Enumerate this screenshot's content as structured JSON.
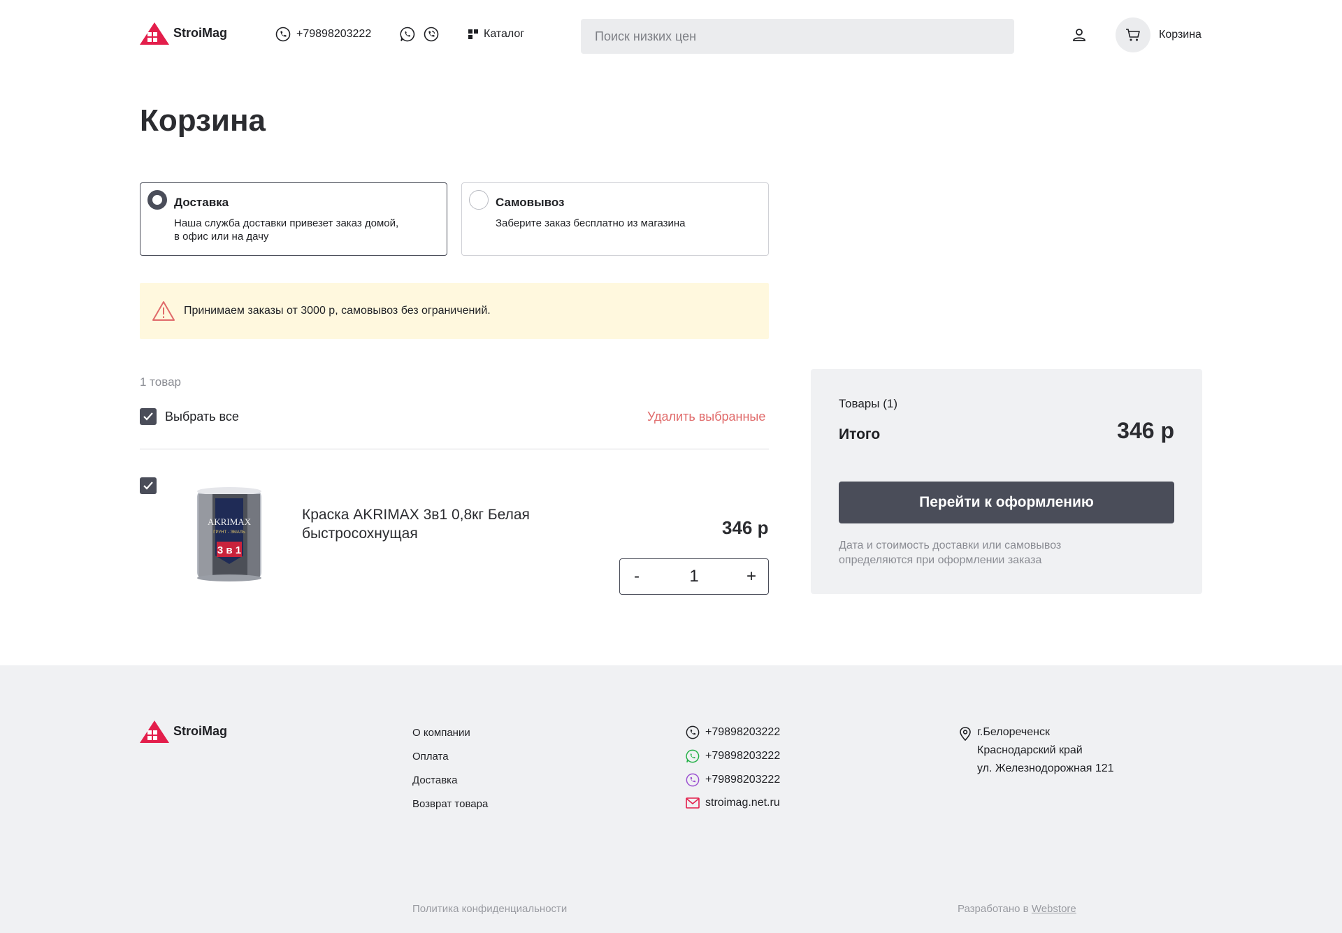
{
  "header": {
    "logo_text": "StroiMag",
    "phone": "+79898203222",
    "catalog_label": "Каталог",
    "search_placeholder": "Поиск низких цен",
    "cart_label": "Корзина"
  },
  "page_title": "Корзина",
  "delivery_options": [
    {
      "title": "Доставка",
      "desc_line1": "Наша служба доставки привезет заказ домой,",
      "desc_line2": "в офис или на дачу",
      "selected": true
    },
    {
      "title": "Самовывоз",
      "desc_line1": "Заберите заказ бесплатно из магазина",
      "desc_line2": "",
      "selected": false
    }
  ],
  "notice": "Принимаем заказы от 3000 р, самовывоз без ограничений.",
  "cart": {
    "count_label": "1 товар",
    "select_all_label": "Выбрать все",
    "delete_selected_label": "Удалить выбранные",
    "items": [
      {
        "name_line1": "Краска AKRIMAX 3в1 0,8кг Белая",
        "name_line2": "быстросохнущая",
        "price": "346 р",
        "quantity": "1",
        "checked": true,
        "image_text_brand": "AKRIMAX",
        "image_text_sub": "ГРУНТ - ЭМАЛЬ",
        "image_text_big": "3 в 1"
      }
    ],
    "minus_label": "-",
    "plus_label": "+"
  },
  "summary": {
    "items_label": "Товары (1)",
    "total_label": "Итого",
    "total_value": "346 р",
    "checkout_label": "Перейти к оформлению",
    "note_line1": "Дата и стоимость доставки или самовывоз",
    "note_line2": "определяются при оформлении заказа"
  },
  "footer": {
    "logo_text": "StroiMag",
    "links": [
      "О компании",
      "Оплата",
      "Доставка",
      "Возврат товара"
    ],
    "contacts": {
      "phone": "+79898203222",
      "whatsapp": "+79898203222",
      "viber": "+79898203222",
      "email": "stroimag.net.ru"
    },
    "address": [
      "г.Белореченск",
      "Краснодарский край",
      "ул. Железнодорожная 121"
    ],
    "privacy": "Политика конфиденциальности",
    "developed_prefix": "Разработано в",
    "developed_link": "Webstore"
  },
  "colors": {
    "brand_red": "#e31e4b",
    "primary_dark": "#4a4d59",
    "danger_text": "#e06a6a",
    "notice_bg": "#fff8de",
    "whatsapp_green": "#25b148",
    "viber_purple": "#9b4fd1"
  },
  "icons": [
    "logo-house-icon",
    "phone-icon",
    "whatsapp-icon",
    "viber-icon",
    "catalog-grid-icon",
    "user-icon",
    "cart-icon",
    "warning-icon",
    "check-icon",
    "location-pin-icon",
    "mail-icon"
  ]
}
